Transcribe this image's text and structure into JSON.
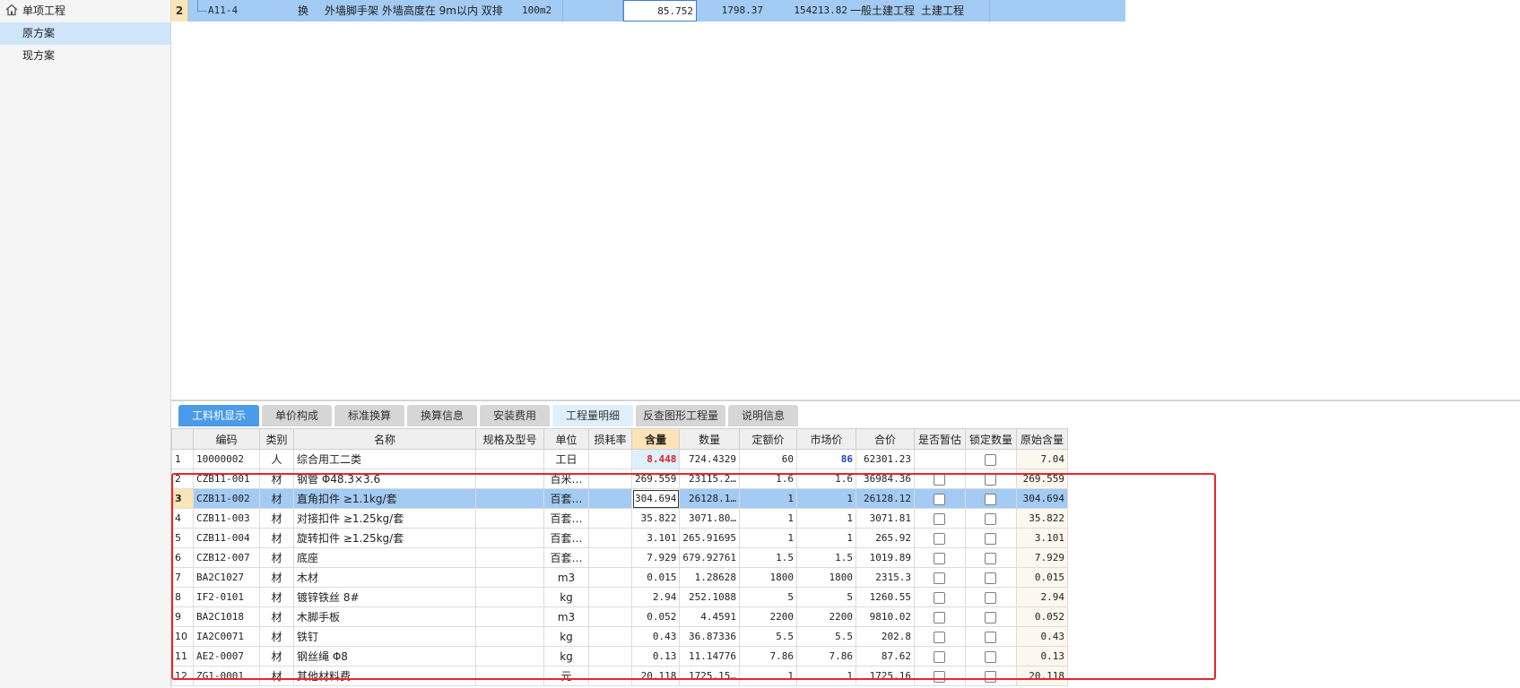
{
  "sidebar": {
    "root_label": "单项工程",
    "items": [
      {
        "label": "原方案",
        "selected": true
      },
      {
        "label": "现方案",
        "selected": false
      }
    ]
  },
  "top_grid": {
    "row": {
      "index": "2",
      "code": "A11-4",
      "type": "换",
      "name": "外墙脚手架 外墙高度在 9m以内 双排",
      "unit": "100m2",
      "quantity": "85.752",
      "unit_price": "1798.37",
      "total": "154213.82",
      "major": "一般土建工程",
      "profession": "土建工程"
    }
  },
  "tabs": [
    {
      "label": "工料机显示",
      "state": "active"
    },
    {
      "label": "单价构成",
      "state": "normal"
    },
    {
      "label": "标准换算",
      "state": "normal"
    },
    {
      "label": "换算信息",
      "state": "normal"
    },
    {
      "label": "安装费用",
      "state": "normal"
    },
    {
      "label": "工程量明细",
      "state": "light"
    },
    {
      "label": "反查图形工程量",
      "state": "normal"
    },
    {
      "label": "说明信息",
      "state": "normal"
    }
  ],
  "detail_grid": {
    "columns": [
      "编码",
      "类别",
      "名称",
      "规格及型号",
      "单位",
      "损耗率",
      "含量",
      "数量",
      "定额价",
      "市场价",
      "合价",
      "是否暂估",
      "锁定数量",
      "原始含量"
    ],
    "rows": [
      {
        "n": "1",
        "code": "10000002",
        "cat": "人",
        "name": "综合用工二类",
        "spec": "",
        "unit": "工日",
        "loss": "",
        "qty": "8.448",
        "amount": "724.4329",
        "base": "60",
        "market": "86",
        "total": "62301.23",
        "temp": false,
        "lock": true,
        "orig": "7.04"
      },
      {
        "n": "2",
        "code": "CZB11-001",
        "cat": "材",
        "name": "钢管 Φ48.3×3.6",
        "spec": "",
        "unit": "百米…",
        "loss": "",
        "qty": "269.559",
        "amount": "23115.2…",
        "base": "1.6",
        "market": "1.6",
        "total": "36984.36",
        "temp": true,
        "lock": true,
        "orig": "269.559"
      },
      {
        "n": "3",
        "code": "CZB11-002",
        "cat": "材",
        "name": "直角扣件 ≥1.1kg/套",
        "spec": "",
        "unit": "百套…",
        "loss": "",
        "qty": "304.694",
        "amount": "26128.1…",
        "base": "1",
        "market": "1",
        "total": "26128.12",
        "temp": true,
        "lock": true,
        "orig": "304.694"
      },
      {
        "n": "4",
        "code": "CZB11-003",
        "cat": "材",
        "name": "对接扣件 ≥1.25kg/套",
        "spec": "",
        "unit": "百套…",
        "loss": "",
        "qty": "35.822",
        "amount": "3071.80…",
        "base": "1",
        "market": "1",
        "total": "3071.81",
        "temp": true,
        "lock": true,
        "orig": "35.822"
      },
      {
        "n": "5",
        "code": "CZB11-004",
        "cat": "材",
        "name": "旋转扣件 ≥1.25kg/套",
        "spec": "",
        "unit": "百套…",
        "loss": "",
        "qty": "3.101",
        "amount": "265.91695",
        "base": "1",
        "market": "1",
        "total": "265.92",
        "temp": true,
        "lock": true,
        "orig": "3.101"
      },
      {
        "n": "6",
        "code": "CZB12-007",
        "cat": "材",
        "name": "底座",
        "spec": "",
        "unit": "百套…",
        "loss": "",
        "qty": "7.929",
        "amount": "679.92761",
        "base": "1.5",
        "market": "1.5",
        "total": "1019.89",
        "temp": true,
        "lock": true,
        "orig": "7.929"
      },
      {
        "n": "7",
        "code": "BA2C1027",
        "cat": "材",
        "name": "木材",
        "spec": "",
        "unit": "m3",
        "loss": "",
        "qty": "0.015",
        "amount": "1.28628",
        "base": "1800",
        "market": "1800",
        "total": "2315.3",
        "temp": true,
        "lock": true,
        "orig": "0.015"
      },
      {
        "n": "8",
        "code": "IF2-0101",
        "cat": "材",
        "name": "镀锌铁丝 8#",
        "spec": "",
        "unit": "kg",
        "loss": "",
        "qty": "2.94",
        "amount": "252.1088",
        "base": "5",
        "market": "5",
        "total": "1260.55",
        "temp": true,
        "lock": true,
        "orig": "2.94"
      },
      {
        "n": "9",
        "code": "BA2C1018",
        "cat": "材",
        "name": "木脚手板",
        "spec": "",
        "unit": "m3",
        "loss": "",
        "qty": "0.052",
        "amount": "4.4591",
        "base": "2200",
        "market": "2200",
        "total": "9810.02",
        "temp": true,
        "lock": true,
        "orig": "0.052"
      },
      {
        "n": "10",
        "code": "IA2C0071",
        "cat": "材",
        "name": "铁钉",
        "spec": "",
        "unit": "kg",
        "loss": "",
        "qty": "0.43",
        "amount": "36.87336",
        "base": "5.5",
        "market": "5.5",
        "total": "202.8",
        "temp": true,
        "lock": true,
        "orig": "0.43"
      },
      {
        "n": "11",
        "code": "AE2-0007",
        "cat": "材",
        "name": "钢丝绳 Φ8",
        "spec": "",
        "unit": "kg",
        "loss": "",
        "qty": "0.13",
        "amount": "11.14776",
        "base": "7.86",
        "market": "7.86",
        "total": "87.62",
        "temp": true,
        "lock": true,
        "orig": "0.13"
      },
      {
        "n": "12",
        "code": "ZG1-0001",
        "cat": "材",
        "name": "其他材料费",
        "spec": "",
        "unit": "元",
        "loss": "",
        "qty": "20.118",
        "amount": "1725.15…",
        "base": "1",
        "market": "1",
        "total": "1725.16",
        "temp": true,
        "lock": true,
        "orig": "20.118"
      }
    ],
    "selected_row": 2
  },
  "colors": {
    "selected_row": "#a3cbf3",
    "active_tab": "#4a9bea",
    "highlight_border": "#e8262a",
    "qty_header": "#fde3b6"
  }
}
